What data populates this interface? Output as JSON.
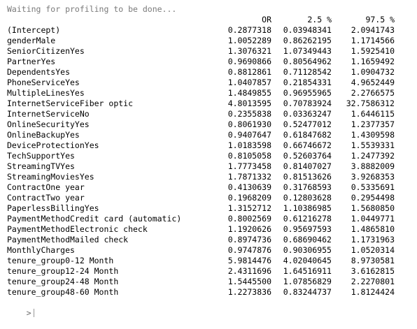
{
  "console": {
    "status_line": "Waiting for profiling to be done...",
    "columns": [
      "OR",
      "2.5 %",
      "97.5 %"
    ],
    "rows": [
      {
        "name": "(Intercept)",
        "or": "0.2877318",
        "lo": "0.03948341",
        "hi": "2.0941743"
      },
      {
        "name": "genderMale",
        "or": "1.0052289",
        "lo": "0.86262195",
        "hi": "1.1714566"
      },
      {
        "name": "SeniorCitizenYes",
        "or": "1.3076321",
        "lo": "1.07349443",
        "hi": "1.5925410"
      },
      {
        "name": "PartnerYes",
        "or": "0.9690866",
        "lo": "0.80564962",
        "hi": "1.1659492"
      },
      {
        "name": "DependentsYes",
        "or": "0.8812861",
        "lo": "0.71128542",
        "hi": "1.0904732"
      },
      {
        "name": "PhoneServiceYes",
        "or": "1.0407857",
        "lo": "0.21854331",
        "hi": "4.9652449"
      },
      {
        "name": "MultipleLinesYes",
        "or": "1.4849855",
        "lo": "0.96955965",
        "hi": "2.2766575"
      },
      {
        "name": "InternetServiceFiber optic",
        "or": "4.8013595",
        "lo": "0.70783924",
        "hi": "32.7586312"
      },
      {
        "name": "InternetServiceNo",
        "or": "0.2355838",
        "lo": "0.03363247",
        "hi": "1.6446115"
      },
      {
        "name": "OnlineSecurityYes",
        "or": "0.8061930",
        "lo": "0.52477012",
        "hi": "1.2377357"
      },
      {
        "name": "OnlineBackupYes",
        "or": "0.9407647",
        "lo": "0.61847682",
        "hi": "1.4309598"
      },
      {
        "name": "DeviceProtectionYes",
        "or": "1.0183598",
        "lo": "0.66746672",
        "hi": "1.5539331"
      },
      {
        "name": "TechSupportYes",
        "or": "0.8105058",
        "lo": "0.52603764",
        "hi": "1.2477392"
      },
      {
        "name": "StreamingTVYes",
        "or": "1.7773458",
        "lo": "0.81407027",
        "hi": "3.8882009"
      },
      {
        "name": "StreamingMoviesYes",
        "or": "1.7871332",
        "lo": "0.81513626",
        "hi": "3.9268353"
      },
      {
        "name": "ContractOne year",
        "or": "0.4130639",
        "lo": "0.31768593",
        "hi": "0.5335691"
      },
      {
        "name": "ContractTwo year",
        "or": "0.1968209",
        "lo": "0.12803628",
        "hi": "0.2954498"
      },
      {
        "name": "PaperlessBillingYes",
        "or": "1.3152712",
        "lo": "1.10386985",
        "hi": "1.5680850"
      },
      {
        "name": "PaymentMethodCredit card (automatic)",
        "or": "0.8002569",
        "lo": "0.61216278",
        "hi": "1.0449771"
      },
      {
        "name": "PaymentMethodElectronic check",
        "or": "1.1920626",
        "lo": "0.95697593",
        "hi": "1.4865810"
      },
      {
        "name": "PaymentMethodMailed check",
        "or": "0.8974736",
        "lo": "0.68690462",
        "hi": "1.1731963"
      },
      {
        "name": "MonthlyCharges",
        "or": "0.9747876",
        "lo": "0.90306955",
        "hi": "1.0520314"
      },
      {
        "name": "tenure_group0-12 Month",
        "or": "5.9814476",
        "lo": "4.02040645",
        "hi": "8.9730581"
      },
      {
        "name": "tenure_group12-24 Month",
        "or": "2.4311696",
        "lo": "1.64516911",
        "hi": "3.6162815"
      },
      {
        "name": "tenure_group24-48 Month",
        "or": "1.5445500",
        "lo": "1.07856829",
        "hi": "2.2270801"
      },
      {
        "name": "tenure_group48-60 Month",
        "or": "1.2273836",
        "lo": "0.83244737",
        "hi": "1.8124424"
      }
    ],
    "prompt_symbol": ">"
  }
}
